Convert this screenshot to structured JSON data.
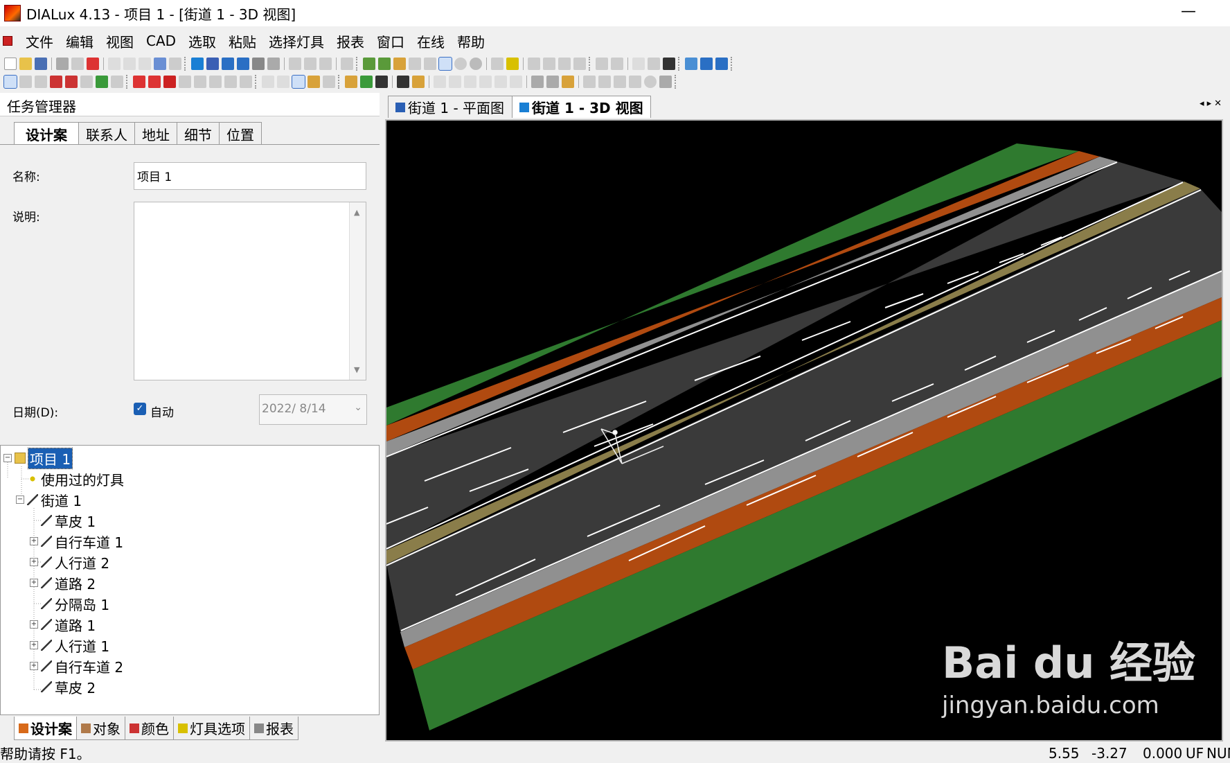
{
  "window": {
    "title": "DIALux 4.13 - 项目 1 - [街道 1 - 3D 视图]",
    "minimize": "—"
  },
  "menu": [
    "文件",
    "编辑",
    "视图",
    "CAD",
    "选取",
    "粘贴",
    "选择灯具",
    "报表",
    "窗口",
    "在线",
    "帮助"
  ],
  "task_manager": {
    "title": "任务管理器",
    "tabs": [
      "设计案",
      "联系人",
      "地址",
      "细节",
      "位置"
    ],
    "active_tab": "设计案",
    "name_label": "名称:",
    "name_value": "项目 1",
    "desc_label": "说明:",
    "date_label": "日期(D):",
    "auto_label": "自动",
    "auto_checked": true,
    "date_value": "2022/  8/14"
  },
  "tree": {
    "root": "项目 1",
    "used_luminaires": "使用过的灯具",
    "street": "街道 1",
    "children": [
      "草皮 1",
      "自行车道 1",
      "人行道 2",
      "道路 2",
      "分隔岛 1",
      "道路 1",
      "人行道 1",
      "自行车道 2",
      "草皮 2"
    ]
  },
  "bottom_tabs": [
    "设计案",
    "对象",
    "颜色",
    "灯具选项",
    "报表"
  ],
  "doc_tabs": [
    "街道 1 - 平面图",
    "街道 1 - 3D 视图"
  ],
  "active_doc_tab": "街道 1 - 3D 视图",
  "watermark": {
    "line1": "Bai du 经验",
    "line2": "jingyan.baidu.com"
  },
  "status": {
    "help": "帮助请按 F1。",
    "x": "5.55",
    "y": "-3.27",
    "z": "0.000",
    "uf": "UF",
    "num": "NUM"
  },
  "colors": {
    "grass": "#2f7a2f",
    "bike_lane": "#b04a10",
    "sidewalk": "#909090",
    "road": "#3a3a3a",
    "median": "#8a7d4a",
    "marking": "#ffffff"
  }
}
